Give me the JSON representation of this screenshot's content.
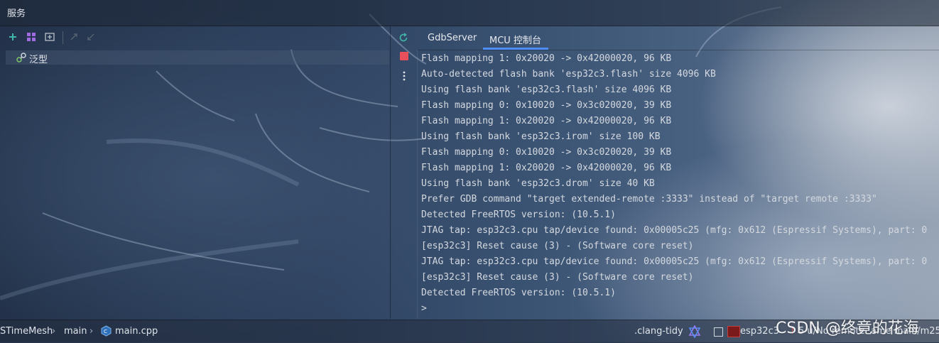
{
  "titlebar": {
    "title": "服务"
  },
  "left_toolbar": {
    "icons": [
      "add-icon",
      "grid-icon",
      "new-tab-icon",
      "expand-icon",
      "collapse-icon"
    ]
  },
  "tree": {
    "item_label": "泛型"
  },
  "side_strip": {
    "icons": [
      "restart-icon",
      "stop-icon",
      "more-vertical-icon"
    ]
  },
  "tabs": [
    {
      "label": "GdbServer",
      "active": false
    },
    {
      "label": "MCU 控制台",
      "active": true
    }
  ],
  "console": {
    "lines": [
      "Flash mapping 1: 0x20020 -> 0x42000020, 96 KB",
      "Auto-detected flash bank 'esp32c3.flash' size 4096 KB",
      "Using flash bank 'esp32c3.flash' size 4096 KB",
      "Flash mapping 0: 0x10020 -> 0x3c020020, 39 KB",
      "Flash mapping 1: 0x20020 -> 0x42000020, 96 KB",
      "Using flash bank 'esp32c3.irom' size 100 KB",
      "Flash mapping 0: 0x10020 -> 0x3c020020, 39 KB",
      "Flash mapping 1: 0x20020 -> 0x42000020, 96 KB",
      "Using flash bank 'esp32c3.drom' size 40 KB",
      "Prefer GDB command \"target extended-remote :3333\" instead of \"target remote :3333\"",
      "Detected FreeRTOS version: (10.5.1)",
      "JTAG tap: esp32c3.cpu tap/device found: 0x00005c25 (mfg: 0x612 (Espressif Systems), part: 0",
      "[esp32c3] Reset cause (3) - (Software core reset)",
      "JTAG tap: esp32c3.cpu tap/device found: 0x00005c25 (mfg: 0x612 (Espressif Systems), part: 0",
      "[esp32c3] Reset cause (3) - (Software core reset)",
      "Detected FreeRTOS version: (10.5.1)",
      ">"
    ]
  },
  "statusbar": {
    "breadcrumb": [
      "STimeMesh",
      "main",
      "main.cpp"
    ],
    "clang_tidy": ".clang-tidy",
    "target": "esp32c3",
    "remote_text": "5 u/No remote",
    "truncated_text": "ame main/m25"
  },
  "watermark": "CSDN @终竟的花海",
  "colors": {
    "accent": "#4f8ef7",
    "stop": "#e8505b",
    "add": "#3fb6a8",
    "grid": "#a06be0"
  }
}
